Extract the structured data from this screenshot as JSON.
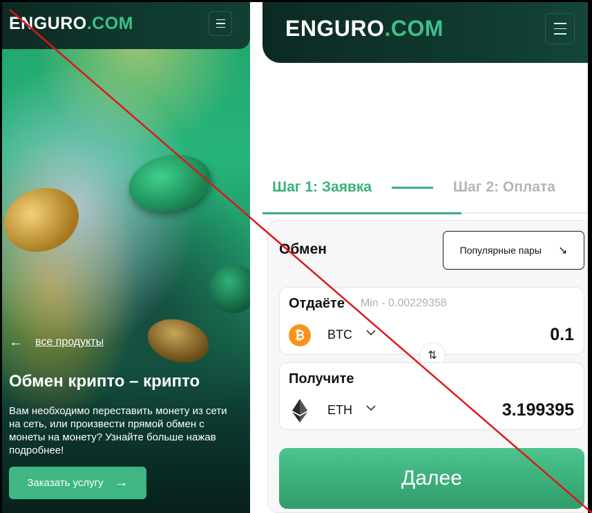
{
  "brand": {
    "name_main": "ENGURO",
    "name_dot": ".COM",
    "accent": "#3fb683"
  },
  "left": {
    "back_link": "все продукты",
    "title": "Обмен крипто – крипто",
    "description": "Вам необходимо переставить монету из сети на сеть, или произвести прямой обмен с монеты на монету? Узнайте больше нажав подробнее!",
    "order_button": "Заказать услугу"
  },
  "right": {
    "steps": [
      {
        "label": "Шаг 1: Заявка",
        "active": true
      },
      {
        "label": "Шаг 2: Оплата",
        "active": false
      }
    ],
    "exchange": {
      "title": "Обмен",
      "popular_pairs": "Популярные пары",
      "give": {
        "label": "Отдаёте",
        "min": "Min - 0.00229358",
        "ticker": "BTC",
        "amount": "0.1"
      },
      "get": {
        "label": "Получите",
        "ticker": "ETH",
        "amount": "3.199395"
      },
      "next_button": "Далее"
    }
  },
  "icons": {
    "menu": "hamburger-icon",
    "back": "arrow-left-icon",
    "order": "arrow-right-icon",
    "popular": "arrow-down-right-icon",
    "swap": "swap-vertical-icon",
    "btc": "bitcoin-icon",
    "eth": "ethereum-icon",
    "chevron": "chevron-down-icon"
  },
  "colors": {
    "dark_header": "#0c2a23",
    "step_active": "#38b07a",
    "step_inactive": "#b5b5b5",
    "btc": "#f7931a"
  }
}
